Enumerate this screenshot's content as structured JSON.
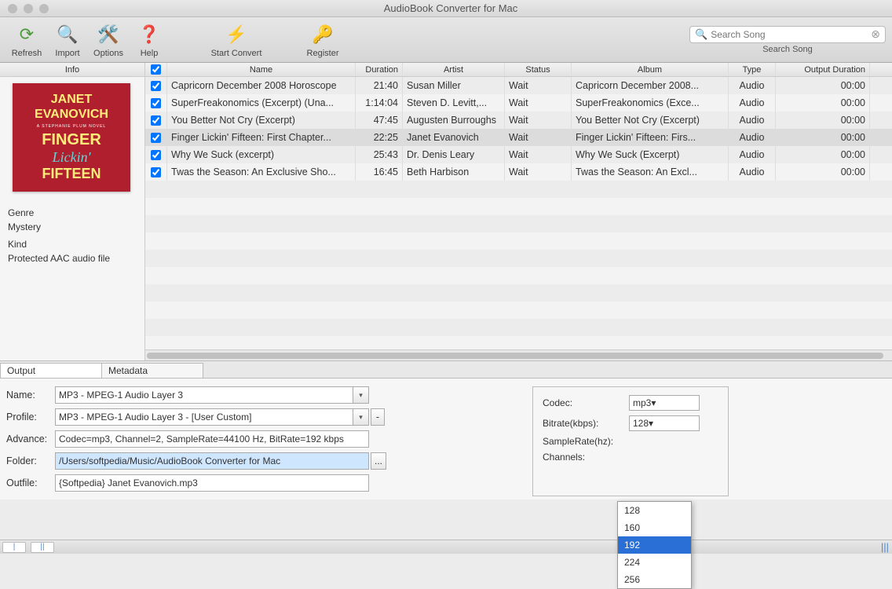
{
  "window_title": "AudioBook Converter for Mac",
  "toolbar": {
    "refresh": "Refresh",
    "import": "Import",
    "options": "Options",
    "help": "Help",
    "start_convert": "Start Convert",
    "register": "Register"
  },
  "search": {
    "placeholder": "Search Song",
    "label": "Search Song"
  },
  "info": {
    "header": "Info",
    "cover": {
      "author": "JANET EVANOVICH",
      "subtitle": "A STEPHANIE PLUM NOVEL",
      "t1": "FINGER",
      "t2": "Lickin'",
      "t3": "FIFTEEN"
    },
    "genre_label": "Genre",
    "genre": "Mystery",
    "kind_label": "Kind",
    "kind": "Protected AAC audio file"
  },
  "columns": {
    "name": "Name",
    "duration": "Duration",
    "artist": "Artist",
    "status": "Status",
    "album": "Album",
    "type": "Type",
    "output_duration": "Output Duration"
  },
  "rows": [
    {
      "name": "Capricorn December 2008 Horoscope",
      "duration": "21:40",
      "artist": "Susan Miller",
      "status": "Wait",
      "album": "Capricorn December 2008...",
      "type": "Audio",
      "out": "00:00"
    },
    {
      "name": "SuperFreakonomics (Excerpt) (Una...",
      "duration": "1:14:04",
      "artist": "Steven D. Levitt,...",
      "status": "Wait",
      "album": "SuperFreakonomics (Exce...",
      "type": "Audio",
      "out": "00:00"
    },
    {
      "name": "You Better Not Cry (Excerpt)",
      "duration": "47:45",
      "artist": "Augusten Burroughs",
      "status": "Wait",
      "album": "You Better Not Cry (Excerpt)",
      "type": "Audio",
      "out": "00:00"
    },
    {
      "name": "Finger Lickin' Fifteen: First Chapter...",
      "duration": "22:25",
      "artist": "Janet Evanovich",
      "status": "Wait",
      "album": "Finger Lickin' Fifteen: Firs...",
      "type": "Audio",
      "out": "00:00",
      "selected": true
    },
    {
      "name": "Why We Suck (excerpt)",
      "duration": "25:43",
      "artist": "Dr. Denis Leary",
      "status": "Wait",
      "album": "Why We Suck (Excerpt)",
      "type": "Audio",
      "out": "00:00"
    },
    {
      "name": "Twas the Season: An Exclusive Sho...",
      "duration": "16:45",
      "artist": "Beth Harbison",
      "status": "Wait",
      "album": "Twas the Season: An Excl...",
      "type": "Audio",
      "out": "00:00"
    }
  ],
  "tabs": {
    "output": "Output",
    "metadata": "Metadata"
  },
  "output_form": {
    "name_label": "Name:",
    "name_value": "MP3 - MPEG-1 Audio Layer 3",
    "profile_label": "Profile:",
    "profile_value": "MP3 - MPEG-1 Audio Layer 3 - [User Custom]",
    "advance_label": "Advance:",
    "advance_value": "Codec=mp3, Channel=2, SampleRate=44100 Hz, BitRate=192 kbps",
    "folder_label": "Folder:",
    "folder_value": "/Users/softpedia/Music/AudioBook Converter for Mac",
    "outfile_label": "Outfile:",
    "outfile_value": "{Softpedia} Janet Evanovich.mp3"
  },
  "codec_panel": {
    "codec_label": "Codec:",
    "codec_value": "mp3",
    "bitrate_label": "Bitrate(kbps):",
    "bitrate_value": "128",
    "samplerate_label": "SampleRate(hz):",
    "channels_label": "Channels:",
    "bitrate_options": [
      "128",
      "160",
      "192",
      "224",
      "256"
    ],
    "bitrate_hover": "192"
  }
}
